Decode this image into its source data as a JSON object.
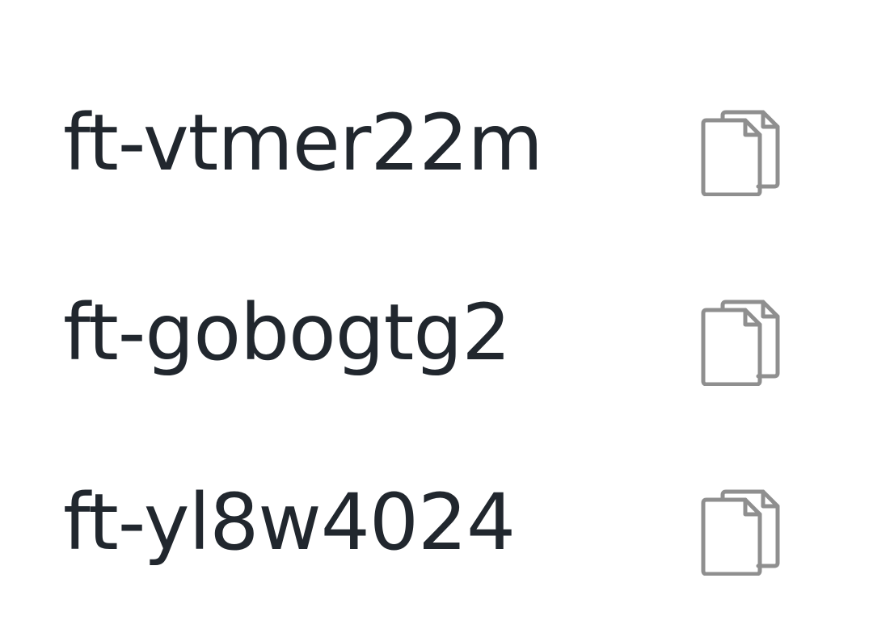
{
  "items": [
    {
      "id": "ft-vtmer22m",
      "action_icon": "copy-icon"
    },
    {
      "id": "ft-gobogtg2",
      "action_icon": "copy-icon"
    },
    {
      "id": "ft-yl8w4024",
      "action_icon": "copy-icon"
    }
  ],
  "colors": {
    "text": "#21272e",
    "icon": "#8f8f8f",
    "background": "#ffffff"
  }
}
